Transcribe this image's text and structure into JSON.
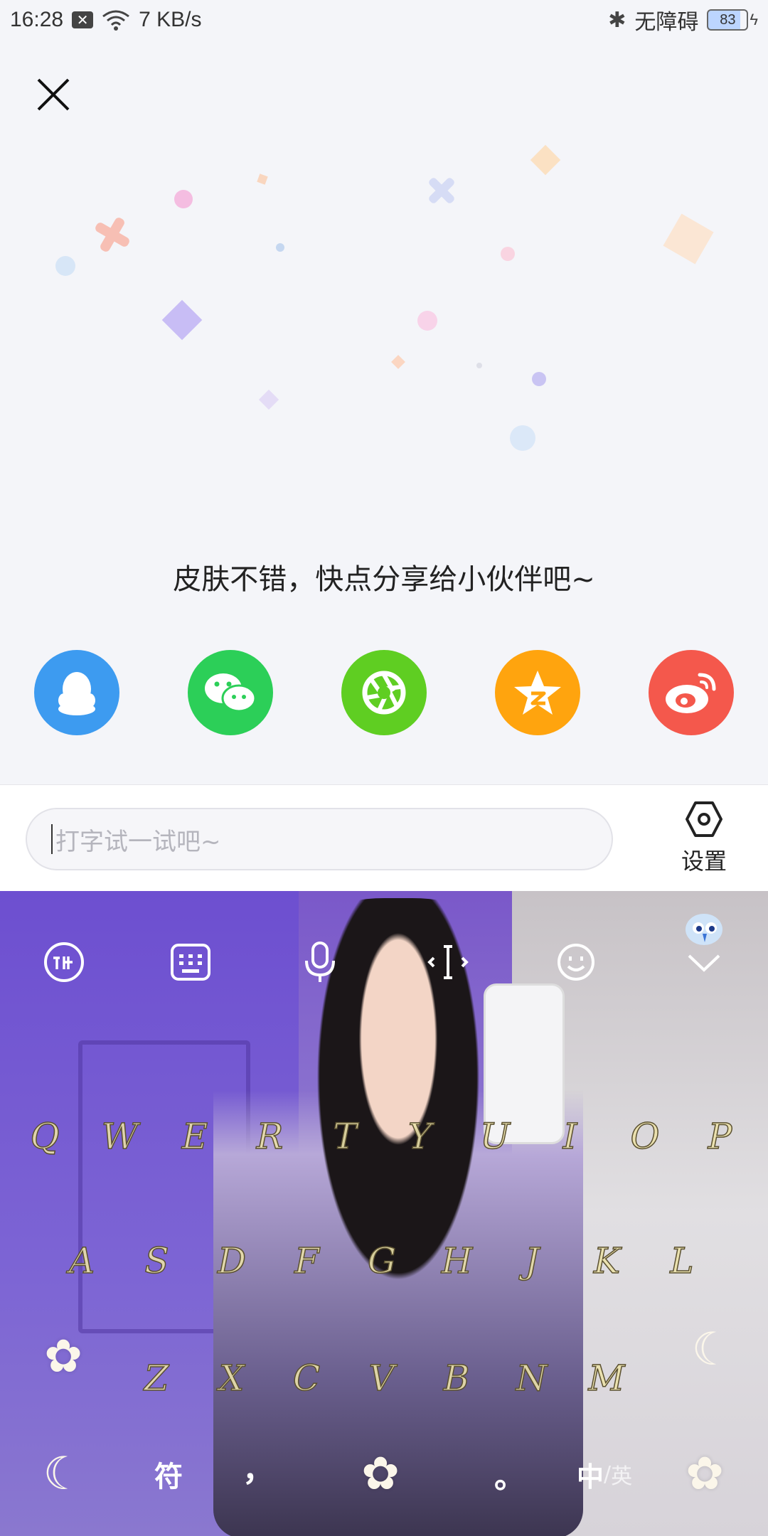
{
  "status_bar": {
    "time": "16:28",
    "net_speed": "7 KB/s",
    "accessibility": "无障碍",
    "battery": "83"
  },
  "share": {
    "title": "皮肤不错，快点分享给小伙伴吧~",
    "targets": [
      {
        "name": "qq-share-button",
        "icon": "qq-penguin-icon",
        "color": "#3d9bf0"
      },
      {
        "name": "wechat-share-button",
        "icon": "wechat-icon",
        "color": "#2ccf58"
      },
      {
        "name": "moments-share-button",
        "icon": "aperture-icon",
        "color": "#5fce22"
      },
      {
        "name": "qzone-share-button",
        "icon": "qzone-star-icon",
        "color": "#ffa40e"
      },
      {
        "name": "weibo-share-button",
        "icon": "weibo-icon",
        "color": "#f4584c"
      }
    ]
  },
  "input_bar": {
    "placeholder": "打字试一试吧~",
    "settings_label": "设置"
  },
  "keyboard": {
    "toolbar": [
      "xunfei-logo-icon",
      "keyboard-icon",
      "microphone-icon",
      "cursor-move-icon",
      "emoji-icon",
      "chevron-down-icon"
    ],
    "row1": [
      "Q",
      "W",
      "E",
      "R",
      "T",
      "Y",
      "U",
      "I",
      "O",
      "P"
    ],
    "row2": [
      "A",
      "S",
      "D",
      "F",
      "G",
      "H",
      "J",
      "K",
      "L"
    ],
    "row3": [
      "Z",
      "X",
      "C",
      "V",
      "B",
      "N",
      "M"
    ],
    "symbol_key": "符",
    "comma_key": "，",
    "period_key": "。",
    "lang_active": "中",
    "lang_sep": "/",
    "lang_inactive": "英"
  }
}
